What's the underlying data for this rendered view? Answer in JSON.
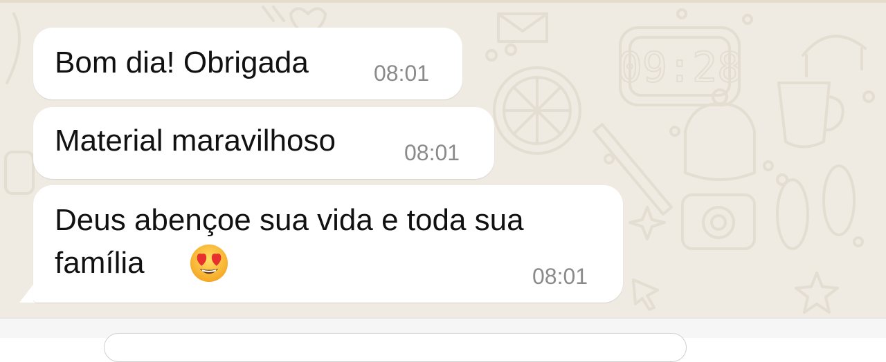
{
  "messages": [
    {
      "text": "Bom dia! Obrigada",
      "time": "08:01"
    },
    {
      "text": "Material maravilhoso",
      "time": "08:01"
    },
    {
      "line1": "Deus abençoe sua vida e toda sua",
      "line2": "família",
      "emoji": "smiling-face-with-heart-eyes",
      "time": "08:01"
    }
  ],
  "wallpaper": {
    "clock_display": "09:28"
  },
  "colors": {
    "chat_background": "#efeae2",
    "bubble": "#ffffff",
    "timestamp": "#8a8a8a",
    "text": "#111111"
  }
}
